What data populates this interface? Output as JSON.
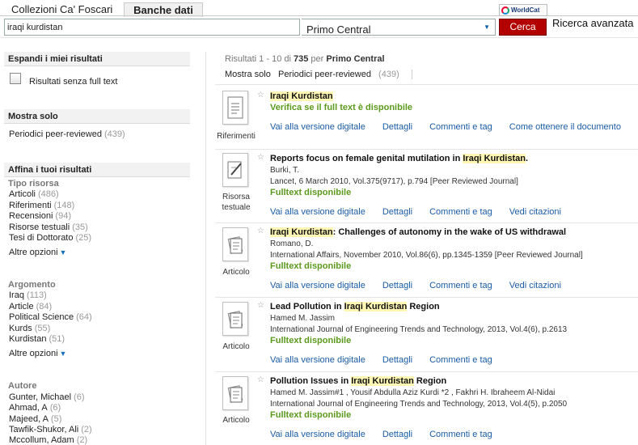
{
  "header": {
    "tabs": [
      "Collezioni Ca' Foscari",
      "Banche dati"
    ],
    "worldcat_label": "WorldCat",
    "search": {
      "value": "iraqi kurdistan",
      "scope": "Primo Central",
      "button": "Cerca",
      "advanced": "Ricerca avanzata"
    }
  },
  "sidebar": {
    "expand": {
      "title": "Espandi i miei risultati",
      "checkbox_label": "Risultati senza full text"
    },
    "show_only": {
      "title": "Mostra solo",
      "items": [
        {
          "label": "Periodici peer-reviewed",
          "count": "(439)"
        }
      ]
    },
    "refine": {
      "title": "Affina i tuoi risultati",
      "groups": [
        {
          "title": "Tipo risorsa",
          "items": [
            {
              "label": "Articoli",
              "count": "(486)"
            },
            {
              "label": "Riferimenti",
              "count": "(148)"
            },
            {
              "label": "Recensioni",
              "count": "(94)"
            },
            {
              "label": "Risorse testuali",
              "count": "(35)"
            },
            {
              "label": "Tesi di Dottorato",
              "count": "(25)"
            }
          ],
          "more": "Altre opzioni"
        },
        {
          "title": "Argomento",
          "items": [
            {
              "label": "Iraq",
              "count": "(113)"
            },
            {
              "label": "Article",
              "count": "(84)"
            },
            {
              "label": "Political Science",
              "count": "(64)"
            },
            {
              "label": "Kurds",
              "count": "(55)"
            },
            {
              "label": "Kurdistan",
              "count": "(51)"
            }
          ],
          "more": "Altre opzioni"
        },
        {
          "title": "Autore",
          "items": [
            {
              "label": "Gunter, Michael",
              "count": "(6)"
            },
            {
              "label": "Ahmad, A",
              "count": "(6)"
            },
            {
              "label": "Majeed, A",
              "count": "(5)"
            },
            {
              "label": "Tawfik-Shukor, Ali",
              "count": "(2)"
            },
            {
              "label": "Mccollum, Adam",
              "count": "(2)"
            }
          ]
        }
      ]
    }
  },
  "results": {
    "summary": {
      "prefix": "Risultati 1 - 10 di",
      "total": "735",
      "per": "per",
      "scope": "Primo Central"
    },
    "filter": {
      "label": "Mostra solo",
      "option": "Periodici peer-reviewed",
      "count": "(439)"
    },
    "records": [
      {
        "type": "Riferimenti",
        "title_before": "",
        "title_hl": "Iraqi Kurdistan",
        "title_after": "",
        "author": "",
        "source": "",
        "availability": "Verifica se il full text è disponibile",
        "links": [
          "Vai alla versione digitale",
          "Dettagli",
          "Commenti e tag",
          "Come ottenere il documento"
        ]
      },
      {
        "type": "Risorsa testuale",
        "title_before": "Reports focus on female genital mutilation in ",
        "title_hl": "Iraqi Kurdistan",
        "title_after": ".",
        "author": "Burki, T.",
        "source": "Lancet, 6 March 2010, Vol.375(9717), p.794 [Peer Reviewed Journal]",
        "availability": "Fulltext disponibile",
        "links": [
          "Vai alla versione digitale",
          "Dettagli",
          "Commenti e tag",
          "Vedi citazioni"
        ]
      },
      {
        "type": "Articolo",
        "title_before": "",
        "title_hl": "Iraqi Kurdistan",
        "title_after": ": Challenges of autonomy in the wake of US withdrawal",
        "author": "Romano, D.",
        "source": "International Affairs, November 2010, Vol.86(6), pp.1345-1359 [Peer Reviewed Journal]",
        "availability": "Fulltext disponibile",
        "links": [
          "Vai alla versione digitale",
          "Dettagli",
          "Commenti e tag",
          "Vedi citazioni"
        ]
      },
      {
        "type": "Articolo",
        "title_before": "Lead Pollution in ",
        "title_hl": "Iraqi Kurdistan",
        "title_after": " Region",
        "author": "Hamed M. Jassim",
        "source": "International Journal of Engineering Trends and Technology, 2013, Vol.4(6), p.2613",
        "availability": "Fulltext disponibile",
        "links": [
          "Vai alla versione digitale",
          "Dettagli",
          "Commenti e tag"
        ]
      },
      {
        "type": "Articolo",
        "title_before": "Pollution Issues in ",
        "title_hl": "Iraqi Kurdistan",
        "title_after": " Region",
        "author": "Hamed M. Jassim#1 , Yousif Abdulla Aziz Kurdi *2 , Fakhri H. Ibraheem Al-Nidai",
        "source": "International Journal of Engineering Trends and Technology, 2013, Vol.4(5), p.2050",
        "availability": "Fulltext disponibile",
        "links": [
          "Vai alla versione digitale",
          "Dettagli",
          "Commenti e tag"
        ]
      }
    ]
  }
}
